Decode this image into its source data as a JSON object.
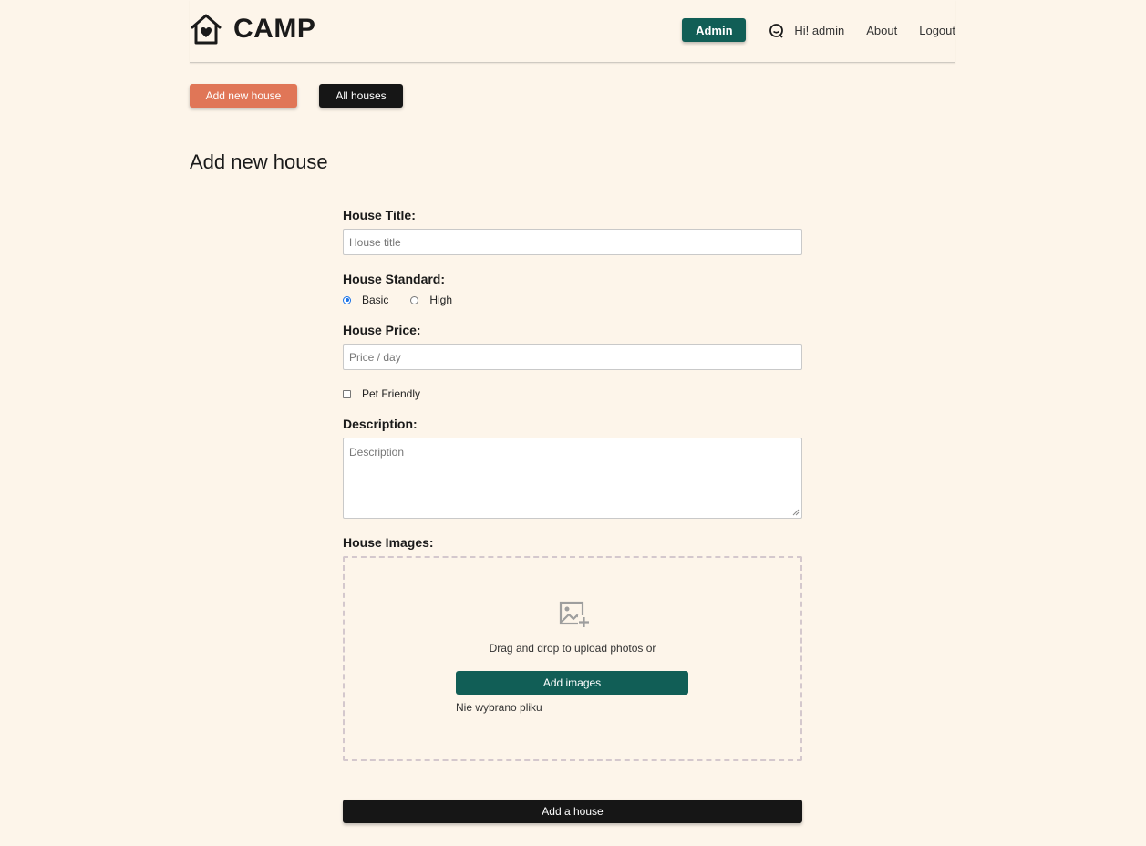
{
  "header": {
    "logo_text": "CAMP",
    "admin_label": "Admin",
    "greeting": "Hi! admin",
    "about_label": "About",
    "logout_label": "Logout"
  },
  "actions": {
    "add_new_label": "Add new house",
    "all_houses_label": "All houses"
  },
  "page_title": "Add new house",
  "form": {
    "title_label": "House Title:",
    "title_placeholder": "House title",
    "standard_label": "House Standard:",
    "standard_options": [
      "Basic",
      "High"
    ],
    "standard_selected": "Basic",
    "price_label": "House Price:",
    "price_placeholder": "Price / day",
    "pet_friendly_label": "Pet Friendly",
    "pet_friendly_checked": false,
    "description_label": "Description:",
    "description_placeholder": "Description",
    "images_label": "House Images:",
    "dropzone_text": "Drag and drop to upload photos or",
    "add_images_label": "Add images",
    "no_file_text": "Nie wybrano pliku",
    "submit_label": "Add a house"
  },
  "colors": {
    "background": "#fdf5ea",
    "primary": "#115e56",
    "accent": "#e07657",
    "dark": "#161616"
  },
  "icons": [
    "home-heart-icon",
    "user-icon",
    "image-add-icon"
  ]
}
